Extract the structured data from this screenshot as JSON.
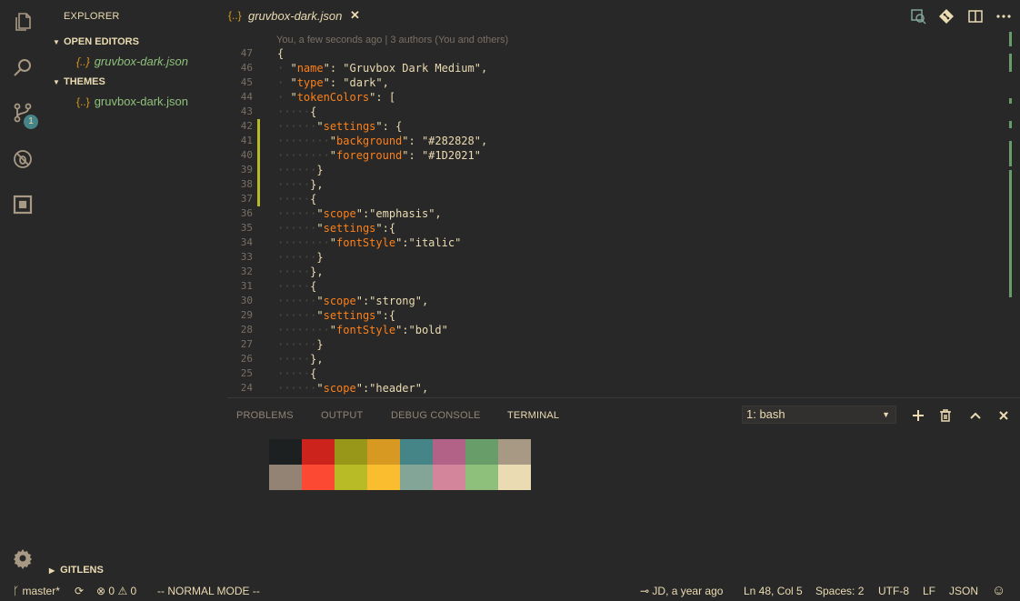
{
  "colors": {
    "bg": "#282828",
    "fg": "#ebdbb2",
    "key": "#fe8019",
    "linenum": "#7c6f64",
    "accent": "#458588",
    "git_modified": "#b8bb26",
    "file_green": "#8ec07c",
    "json_icon": "#d79921"
  },
  "activity_bar": {
    "icons": [
      "files-icon",
      "search-icon",
      "source-control-icon",
      "debug-icon",
      "extensions-icon",
      "settings-gear-icon"
    ],
    "scm_badge": "1"
  },
  "sidebar": {
    "title": "EXPLORER",
    "open_editors_label": "OPEN EDITORS",
    "open_editors": [
      {
        "icon": "{..}",
        "name": "gruvbox-dark.json"
      }
    ],
    "themes_label": "THEMES",
    "themes": [
      {
        "icon": "{..}",
        "name": "gruvbox-dark.json"
      }
    ],
    "gitlens_label": "GITLENS"
  },
  "tab": {
    "icon": "{..}",
    "name": "gruvbox-dark.json",
    "close_symbol": "✕"
  },
  "title_actions": [
    "open-changes-icon",
    "git-compare-icon",
    "split-editor-icon",
    "more-actions-icon"
  ],
  "blame": "You, a few seconds ago | 3 authors (You and others)",
  "editor_lines": [
    {
      "n": "47",
      "parts": [
        [
          "p",
          "{"
        ]
      ]
    },
    {
      "n": "46",
      "parts": [
        [
          "d",
          "·"
        ],
        [
          "p",
          " \""
        ],
        [
          "k",
          "name"
        ],
        [
          "p",
          "\": \"Gruvbox Dark Medium\","
        ]
      ]
    },
    {
      "n": "45",
      "parts": [
        [
          "d",
          "·"
        ],
        [
          "p",
          " \""
        ],
        [
          "k",
          "type"
        ],
        [
          "p",
          "\": \"dark\","
        ]
      ]
    },
    {
      "n": "44",
      "parts": [
        [
          "d",
          "·"
        ],
        [
          "p",
          " \""
        ],
        [
          "k",
          "tokenColors"
        ],
        [
          "p",
          "\": ["
        ]
      ]
    },
    {
      "n": "43",
      "parts": [
        [
          "d",
          "·····"
        ],
        [
          "p",
          "{"
        ]
      ]
    },
    {
      "n": "42",
      "parts": [
        [
          "d",
          "······"
        ],
        [
          "p",
          "\""
        ],
        [
          "k",
          "settings"
        ],
        [
          "p",
          "\": {"
        ]
      ]
    },
    {
      "n": "41",
      "parts": [
        [
          "d",
          "········"
        ],
        [
          "p",
          "\""
        ],
        [
          "k",
          "background"
        ],
        [
          "p",
          "\": \"#282828\","
        ]
      ]
    },
    {
      "n": "40",
      "parts": [
        [
          "d",
          "········"
        ],
        [
          "p",
          "\""
        ],
        [
          "k",
          "foreground"
        ],
        [
          "p",
          "\": \"#1D2021\""
        ]
      ]
    },
    {
      "n": "39",
      "parts": [
        [
          "d",
          "······"
        ],
        [
          "p",
          "}"
        ]
      ]
    },
    {
      "n": "38",
      "parts": [
        [
          "d",
          "·····"
        ],
        [
          "p",
          "},"
        ]
      ]
    },
    {
      "n": "37",
      "parts": [
        [
          "d",
          "·····"
        ],
        [
          "p",
          "{"
        ]
      ]
    },
    {
      "n": "36",
      "parts": [
        [
          "d",
          "······"
        ],
        [
          "p",
          "\""
        ],
        [
          "k",
          "scope"
        ],
        [
          "p",
          "\":\"emphasis\","
        ]
      ]
    },
    {
      "n": "35",
      "parts": [
        [
          "d",
          "······"
        ],
        [
          "p",
          "\""
        ],
        [
          "k",
          "settings"
        ],
        [
          "p",
          "\":{"
        ]
      ]
    },
    {
      "n": "34",
      "parts": [
        [
          "d",
          "········"
        ],
        [
          "p",
          "\""
        ],
        [
          "k",
          "fontStyle"
        ],
        [
          "p",
          "\":\"italic\""
        ]
      ]
    },
    {
      "n": "33",
      "parts": [
        [
          "d",
          "······"
        ],
        [
          "p",
          "}"
        ]
      ]
    },
    {
      "n": "32",
      "parts": [
        [
          "d",
          "·····"
        ],
        [
          "p",
          "},"
        ]
      ]
    },
    {
      "n": "31",
      "parts": [
        [
          "d",
          "·····"
        ],
        [
          "p",
          "{"
        ]
      ]
    },
    {
      "n": "30",
      "parts": [
        [
          "d",
          "······"
        ],
        [
          "p",
          "\""
        ],
        [
          "k",
          "scope"
        ],
        [
          "p",
          "\":\"strong\","
        ]
      ]
    },
    {
      "n": "29",
      "parts": [
        [
          "d",
          "······"
        ],
        [
          "p",
          "\""
        ],
        [
          "k",
          "settings"
        ],
        [
          "p",
          "\":{"
        ]
      ]
    },
    {
      "n": "28",
      "parts": [
        [
          "d",
          "········"
        ],
        [
          "p",
          "\""
        ],
        [
          "k",
          "fontStyle"
        ],
        [
          "p",
          "\":\"bold\""
        ]
      ]
    },
    {
      "n": "27",
      "parts": [
        [
          "d",
          "······"
        ],
        [
          "p",
          "}"
        ]
      ]
    },
    {
      "n": "26",
      "parts": [
        [
          "d",
          "·····"
        ],
        [
          "p",
          "},"
        ]
      ]
    },
    {
      "n": "25",
      "parts": [
        [
          "d",
          "·····"
        ],
        [
          "p",
          "{"
        ]
      ]
    },
    {
      "n": "24",
      "parts": [
        [
          "d",
          "······"
        ],
        [
          "p",
          "\""
        ],
        [
          "k",
          "scope"
        ],
        [
          "p",
          "\":\"header\","
        ]
      ]
    }
  ],
  "panel": {
    "tabs": [
      "PROBLEMS",
      "OUTPUT",
      "DEBUG CONSOLE",
      "TERMINAL"
    ],
    "active_tab": "TERMINAL",
    "terminal_select": "1: bash",
    "actions": [
      "add-terminal-icon",
      "trash-icon",
      "maximize-panel-icon",
      "close-panel-icon"
    ],
    "swatches_row1": [
      "#1d2021",
      "#cc241d",
      "#98971a",
      "#d79921",
      "#458588",
      "#b16286",
      "#689d6a",
      "#a89984"
    ],
    "swatches_row2": [
      "#928374",
      "#fb4934",
      "#b8bb26",
      "#fabd2f",
      "#83a598",
      "#d3869b",
      "#8ec07c",
      "#ebdbb2"
    ]
  },
  "status": {
    "branch": "master*",
    "errors": "0",
    "warnings": "0",
    "mode": "-- NORMAL MODE --",
    "blame": "JD, a year ago",
    "position": "Ln 48, Col 5",
    "spaces": "Spaces: 2",
    "encoding": "UTF-8",
    "eol": "LF",
    "language": "JSON"
  }
}
